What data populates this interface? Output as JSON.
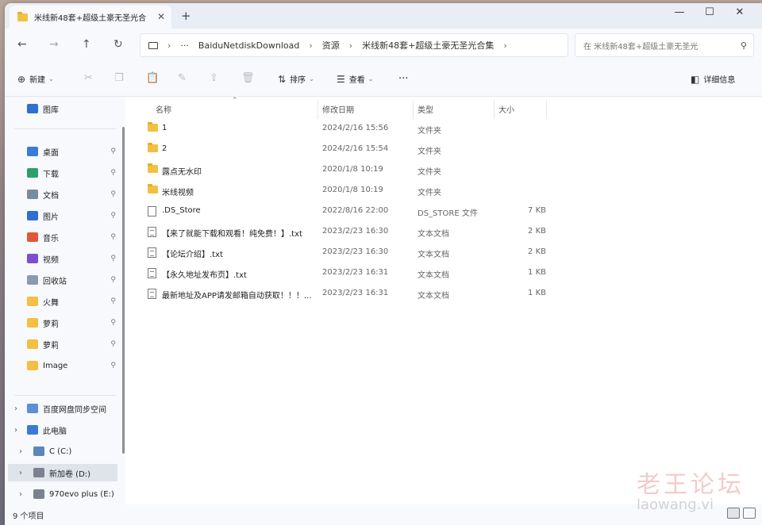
{
  "window": {
    "tab_title": "米线新48套+超级土豪无圣光合",
    "new_tab": "+",
    "close_tab": "✕",
    "minimize": "—",
    "maximize": "☐",
    "close": "✕"
  },
  "nav": {
    "back": "←",
    "forward": "→",
    "up": "↑",
    "refresh": "↻",
    "address_parts": [
      "BaiduNetdiskDownload",
      "资源",
      "米线新48套+超级土豪无圣光合集"
    ],
    "more_dots": "···",
    "search_placeholder": "在 米线新48套+超级土豪无圣光",
    "search_icon": "search-icon"
  },
  "toolbar": {
    "new_label": "新建",
    "sort_label": "排序",
    "view_label": "查看",
    "more_label": "···",
    "details_label": "详细信息"
  },
  "sidebar": {
    "items": [
      {
        "label": "图库",
        "icon": "image-icon",
        "color": "#2f6fcf"
      },
      {
        "label": "桌面",
        "icon": "desktop-icon",
        "color": "#3a7bd5",
        "pinned": true
      },
      {
        "label": "下载",
        "icon": "download-icon",
        "color": "#2e9e6b",
        "pinned": true
      },
      {
        "label": "文档",
        "icon": "document-icon",
        "color": "#7a8aa0",
        "pinned": true
      },
      {
        "label": "图片",
        "icon": "pictures-icon",
        "color": "#2f6fcf",
        "pinned": true
      },
      {
        "label": "音乐",
        "icon": "music-icon",
        "color": "#e0573a",
        "pinned": true
      },
      {
        "label": "视频",
        "icon": "video-icon",
        "color": "#7a4fd0",
        "pinned": true
      },
      {
        "label": "回收站",
        "icon": "recycle-bin-icon",
        "color": "#8a9bb0",
        "pinned": true
      },
      {
        "label": "火舞",
        "icon": "folder-icon",
        "color": "#f2c143",
        "pinned": true
      },
      {
        "label": "萝莉",
        "icon": "folder-icon",
        "color": "#f2c143",
        "pinned": true
      },
      {
        "label": "萝莉",
        "icon": "folder-icon",
        "color": "#f2c143",
        "pinned": true
      },
      {
        "label": "Image",
        "icon": "folder-icon",
        "color": "#f2c143",
        "pinned": true
      },
      {
        "label": "百度网盘同步空间",
        "icon": "cloud-drive-icon",
        "color": "#5b8fd6"
      },
      {
        "label": "此电脑",
        "icon": "computer-icon",
        "color": "#3a7bd5"
      },
      {
        "label": "C (C:)",
        "icon": "drive-icon",
        "color": "#5c86b8"
      },
      {
        "label": "新加卷 (D:)",
        "icon": "drive-icon",
        "color": "#7a8290"
      },
      {
        "label": "970evo plus (E:)",
        "icon": "drive-icon",
        "color": "#7a8290"
      }
    ],
    "pin_glyph": "📌",
    "chevron": "›"
  },
  "columns": {
    "name": "名称",
    "modified": "修改日期",
    "type": "类型",
    "size": "大小"
  },
  "files": [
    {
      "name": "1",
      "modified": "2024/2/16 15:56",
      "type": "文件夹",
      "size": "",
      "kind": "folder"
    },
    {
      "name": "2",
      "modified": "2024/2/16 15:54",
      "type": "文件夹",
      "size": "",
      "kind": "folder"
    },
    {
      "name": "露点无水印",
      "modified": "2020/1/8 10:19",
      "type": "文件夹",
      "size": "",
      "kind": "folder"
    },
    {
      "name": "米线视频",
      "modified": "2020/1/8 10:19",
      "type": "文件夹",
      "size": "",
      "kind": "folder"
    },
    {
      "name": ".DS_Store",
      "modified": "2022/8/16 22:00",
      "type": "DS_STORE 文件",
      "size": "7 KB",
      "kind": "file"
    },
    {
      "name": "【来了就能下载和观看！纯免费！】.txt",
      "modified": "2023/2/23 16:30",
      "type": "文本文档",
      "size": "2 KB",
      "kind": "txt"
    },
    {
      "name": "【论坛介绍】.txt",
      "modified": "2023/2/23 16:30",
      "type": "文本文档",
      "size": "2 KB",
      "kind": "txt"
    },
    {
      "name": "【永久地址发布页】.txt",
      "modified": "2023/2/23 16:31",
      "type": "文本文档",
      "size": "1 KB",
      "kind": "txt"
    },
    {
      "name": "最新地址及APP请发邮箱自动获取！！！...",
      "modified": "2023/2/23 16:31",
      "type": "文本文档",
      "size": "1 KB",
      "kind": "txt"
    }
  ],
  "status": {
    "count": "9 个项目"
  },
  "watermark": {
    "line1": "老王论坛",
    "line2": "laowang.vi"
  }
}
